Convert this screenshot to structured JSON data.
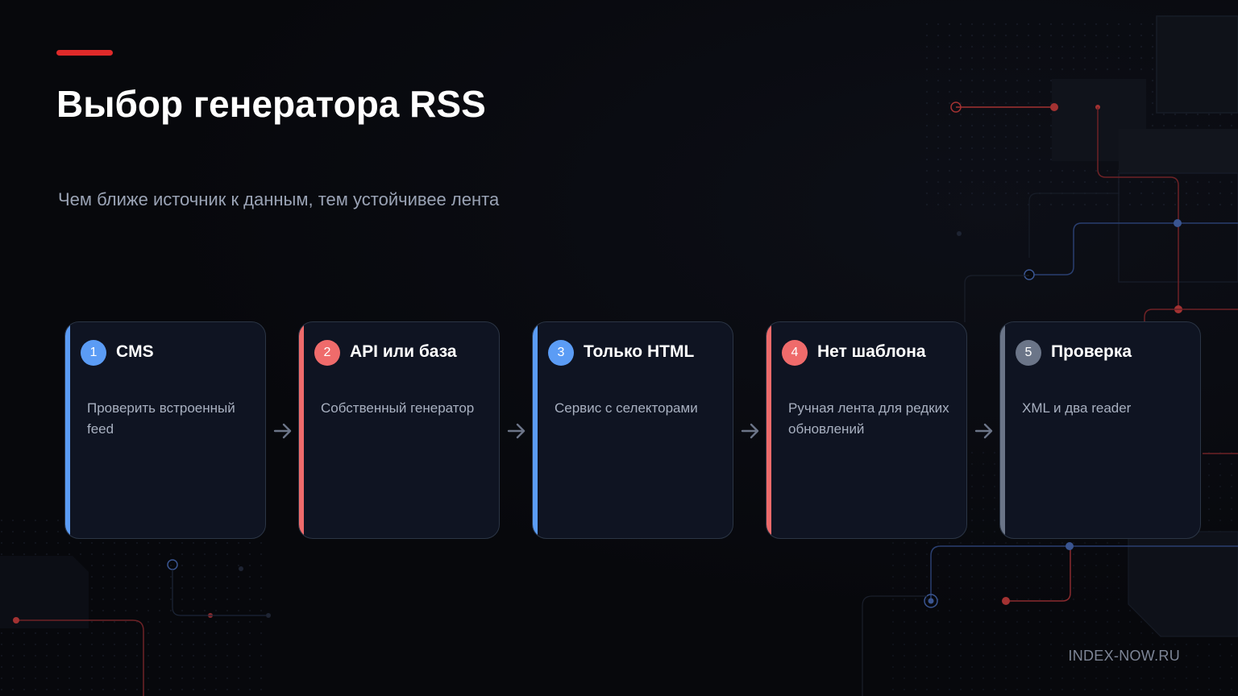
{
  "header": {
    "title": "Выбор генератора RSS",
    "subtitle": "Чем ближе источник к данным, тем устойчивее лента"
  },
  "colors": {
    "accent_red": "#e02a2a",
    "blue": "#5b9cf5",
    "coral": "#ef6b6b",
    "gray": "#6b7588"
  },
  "steps": [
    {
      "number": "1",
      "title": "CMS",
      "description": "Проверить встроенный feed",
      "color": "#5b9cf5"
    },
    {
      "number": "2",
      "title": "API или база",
      "description": "Собственный генератор",
      "color": "#ef6b6b"
    },
    {
      "number": "3",
      "title": "Только HTML",
      "description": "Сервис с селекторами",
      "color": "#5b9cf5"
    },
    {
      "number": "4",
      "title": "Нет шаблона",
      "description": "Ручная лента для редких обновлений",
      "color": "#ef6b6b"
    },
    {
      "number": "5",
      "title": "Проверка",
      "description": "XML и два reader",
      "color": "#6b7588"
    }
  ],
  "arrow_icon": "arrow-right-icon",
  "footer": {
    "brand": "INDEX-NOW.RU"
  }
}
